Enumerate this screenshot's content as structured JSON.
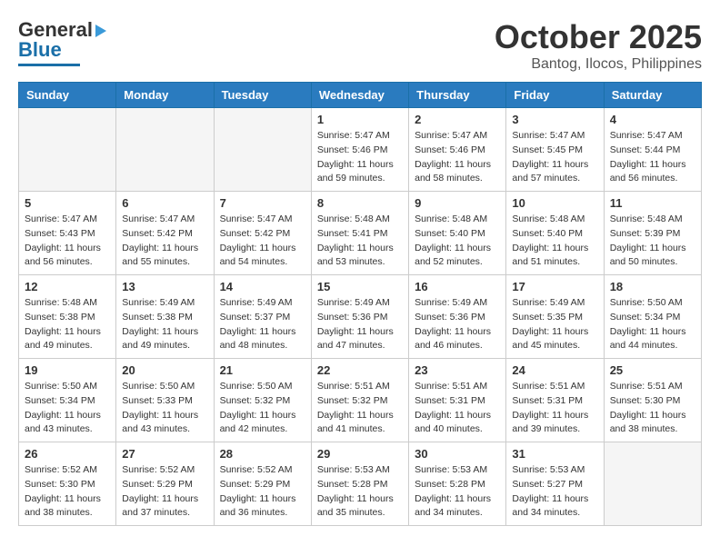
{
  "header": {
    "logo_line1": "General",
    "logo_line2": "Blue",
    "month": "October 2025",
    "location": "Bantog, Ilocos, Philippines"
  },
  "days_of_week": [
    "Sunday",
    "Monday",
    "Tuesday",
    "Wednesday",
    "Thursday",
    "Friday",
    "Saturday"
  ],
  "weeks": [
    [
      {
        "day": "",
        "info": ""
      },
      {
        "day": "",
        "info": ""
      },
      {
        "day": "",
        "info": ""
      },
      {
        "day": "1",
        "info": "Sunrise: 5:47 AM\nSunset: 5:46 PM\nDaylight: 11 hours\nand 59 minutes."
      },
      {
        "day": "2",
        "info": "Sunrise: 5:47 AM\nSunset: 5:46 PM\nDaylight: 11 hours\nand 58 minutes."
      },
      {
        "day": "3",
        "info": "Sunrise: 5:47 AM\nSunset: 5:45 PM\nDaylight: 11 hours\nand 57 minutes."
      },
      {
        "day": "4",
        "info": "Sunrise: 5:47 AM\nSunset: 5:44 PM\nDaylight: 11 hours\nand 56 minutes."
      }
    ],
    [
      {
        "day": "5",
        "info": "Sunrise: 5:47 AM\nSunset: 5:43 PM\nDaylight: 11 hours\nand 56 minutes."
      },
      {
        "day": "6",
        "info": "Sunrise: 5:47 AM\nSunset: 5:42 PM\nDaylight: 11 hours\nand 55 minutes."
      },
      {
        "day": "7",
        "info": "Sunrise: 5:47 AM\nSunset: 5:42 PM\nDaylight: 11 hours\nand 54 minutes."
      },
      {
        "day": "8",
        "info": "Sunrise: 5:48 AM\nSunset: 5:41 PM\nDaylight: 11 hours\nand 53 minutes."
      },
      {
        "day": "9",
        "info": "Sunrise: 5:48 AM\nSunset: 5:40 PM\nDaylight: 11 hours\nand 52 minutes."
      },
      {
        "day": "10",
        "info": "Sunrise: 5:48 AM\nSunset: 5:40 PM\nDaylight: 11 hours\nand 51 minutes."
      },
      {
        "day": "11",
        "info": "Sunrise: 5:48 AM\nSunset: 5:39 PM\nDaylight: 11 hours\nand 50 minutes."
      }
    ],
    [
      {
        "day": "12",
        "info": "Sunrise: 5:48 AM\nSunset: 5:38 PM\nDaylight: 11 hours\nand 49 minutes."
      },
      {
        "day": "13",
        "info": "Sunrise: 5:49 AM\nSunset: 5:38 PM\nDaylight: 11 hours\nand 49 minutes."
      },
      {
        "day": "14",
        "info": "Sunrise: 5:49 AM\nSunset: 5:37 PM\nDaylight: 11 hours\nand 48 minutes."
      },
      {
        "day": "15",
        "info": "Sunrise: 5:49 AM\nSunset: 5:36 PM\nDaylight: 11 hours\nand 47 minutes."
      },
      {
        "day": "16",
        "info": "Sunrise: 5:49 AM\nSunset: 5:36 PM\nDaylight: 11 hours\nand 46 minutes."
      },
      {
        "day": "17",
        "info": "Sunrise: 5:49 AM\nSunset: 5:35 PM\nDaylight: 11 hours\nand 45 minutes."
      },
      {
        "day": "18",
        "info": "Sunrise: 5:50 AM\nSunset: 5:34 PM\nDaylight: 11 hours\nand 44 minutes."
      }
    ],
    [
      {
        "day": "19",
        "info": "Sunrise: 5:50 AM\nSunset: 5:34 PM\nDaylight: 11 hours\nand 43 minutes."
      },
      {
        "day": "20",
        "info": "Sunrise: 5:50 AM\nSunset: 5:33 PM\nDaylight: 11 hours\nand 43 minutes."
      },
      {
        "day": "21",
        "info": "Sunrise: 5:50 AM\nSunset: 5:32 PM\nDaylight: 11 hours\nand 42 minutes."
      },
      {
        "day": "22",
        "info": "Sunrise: 5:51 AM\nSunset: 5:32 PM\nDaylight: 11 hours\nand 41 minutes."
      },
      {
        "day": "23",
        "info": "Sunrise: 5:51 AM\nSunset: 5:31 PM\nDaylight: 11 hours\nand 40 minutes."
      },
      {
        "day": "24",
        "info": "Sunrise: 5:51 AM\nSunset: 5:31 PM\nDaylight: 11 hours\nand 39 minutes."
      },
      {
        "day": "25",
        "info": "Sunrise: 5:51 AM\nSunset: 5:30 PM\nDaylight: 11 hours\nand 38 minutes."
      }
    ],
    [
      {
        "day": "26",
        "info": "Sunrise: 5:52 AM\nSunset: 5:30 PM\nDaylight: 11 hours\nand 38 minutes."
      },
      {
        "day": "27",
        "info": "Sunrise: 5:52 AM\nSunset: 5:29 PM\nDaylight: 11 hours\nand 37 minutes."
      },
      {
        "day": "28",
        "info": "Sunrise: 5:52 AM\nSunset: 5:29 PM\nDaylight: 11 hours\nand 36 minutes."
      },
      {
        "day": "29",
        "info": "Sunrise: 5:53 AM\nSunset: 5:28 PM\nDaylight: 11 hours\nand 35 minutes."
      },
      {
        "day": "30",
        "info": "Sunrise: 5:53 AM\nSunset: 5:28 PM\nDaylight: 11 hours\nand 34 minutes."
      },
      {
        "day": "31",
        "info": "Sunrise: 5:53 AM\nSunset: 5:27 PM\nDaylight: 11 hours\nand 34 minutes."
      },
      {
        "day": "",
        "info": ""
      }
    ]
  ]
}
